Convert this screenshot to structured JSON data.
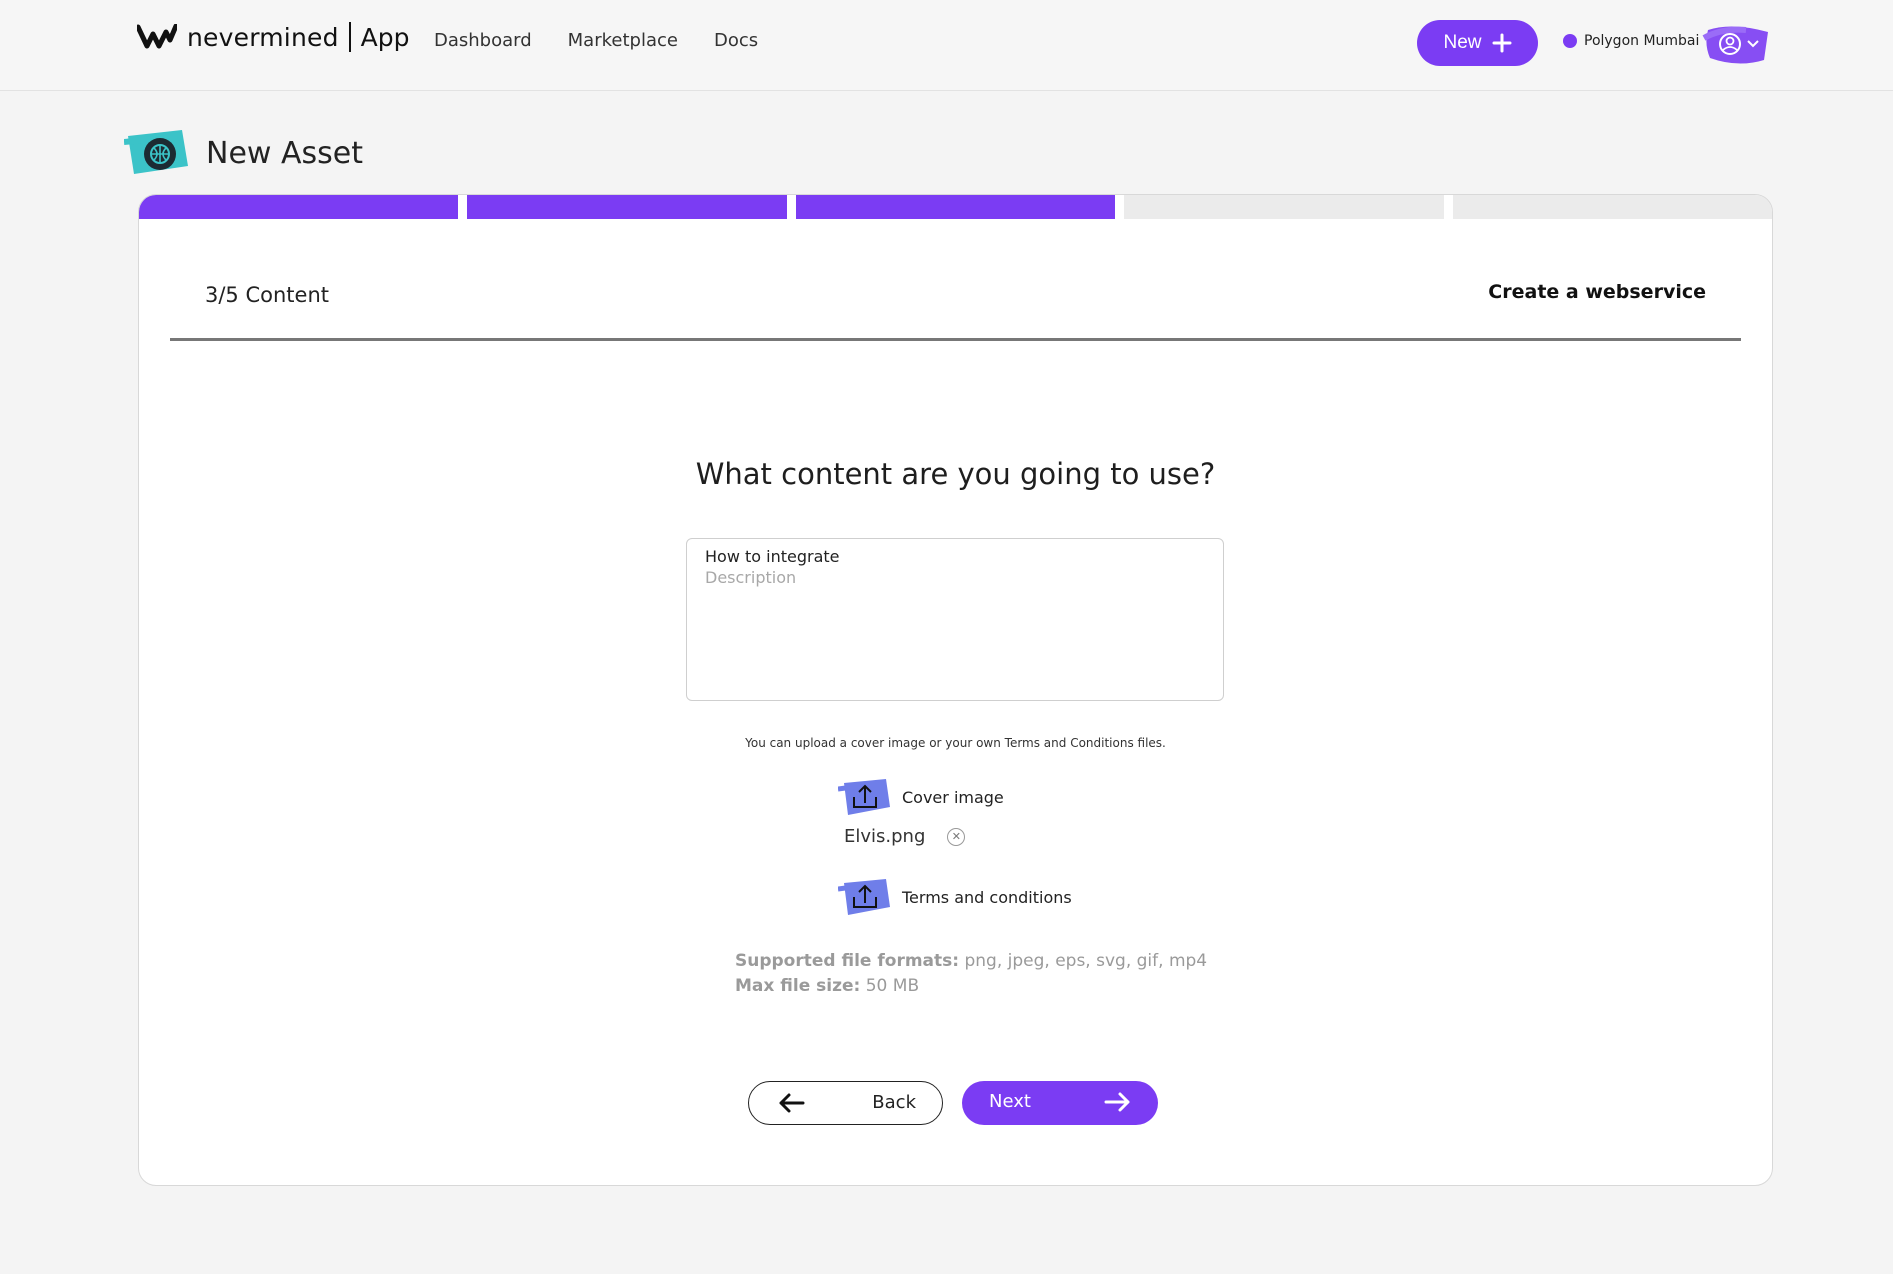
{
  "header": {
    "logo_word": "nevermined",
    "logo_app": "App",
    "nav": [
      "Dashboard",
      "Marketplace",
      "Docs"
    ],
    "new_button": "New",
    "network": "Polygon Mumbai"
  },
  "page": {
    "title": "New Asset"
  },
  "wizard": {
    "steps_total": 5,
    "steps_completed": 3,
    "step_label": "3/5 Content",
    "service_label": "Create a webservice",
    "question": "What content are you going to use?",
    "content_field": {
      "label": "How to integrate",
      "placeholder": "Description"
    },
    "upload_hint": "You can upload a cover image or your own Terms and Conditions files.",
    "cover_upload_label": "Cover image",
    "cover_file": "Elvis.png",
    "terms_upload_label": "Terms and conditions",
    "formats_label": "Supported file formats:",
    "formats_value": "png, jpeg, eps, svg, gif, mp4",
    "size_label": "Max file size:",
    "size_value": "50 MB",
    "back_button": "Back",
    "next_button": "Next"
  },
  "colors": {
    "accent": "#7b3cf3",
    "teal": "#3bc3c8",
    "upload_blue": "#6f7ee9"
  }
}
